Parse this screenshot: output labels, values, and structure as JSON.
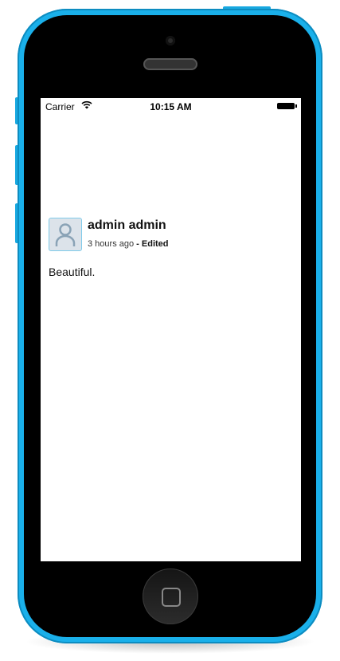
{
  "status_bar": {
    "carrier": "Carrier",
    "time": "10:15 AM",
    "wifi_icon": "wifi-icon",
    "battery_icon": "battery-icon"
  },
  "post": {
    "author": "admin admin",
    "time_ago": "3 hours ago",
    "edited": "- Edited",
    "body": "Beautiful.",
    "avatar_icon": "user-icon"
  },
  "device": {
    "color": "#1ab0ea"
  }
}
